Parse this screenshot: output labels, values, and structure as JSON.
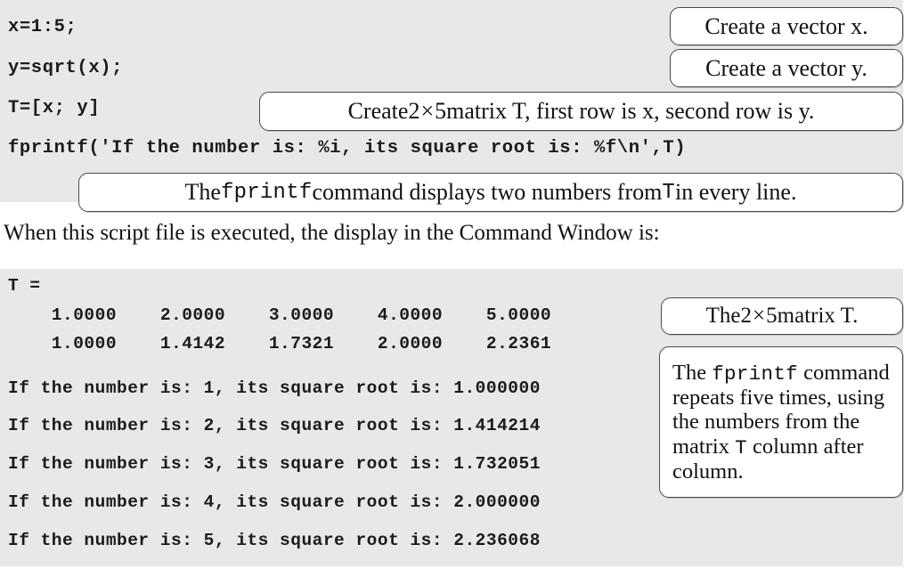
{
  "script_panel": {
    "lines": [
      "x=1:5;",
      "y=sqrt(x);",
      "T=[x; y]",
      "fprintf('If the number is: %i, its square root is: %f\\n',T)"
    ]
  },
  "body_text": {
    "sentence": "When this script file is executed, the display in the Command Window is:"
  },
  "output_panel": {
    "variable_header": "T =",
    "matrix_row_1": "    1.0000    2.0000    3.0000    4.0000    5.0000",
    "matrix_row_2": "    1.0000    1.4142    1.7321    2.0000    2.2361",
    "fprintf_lines": [
      "If the number is: 1, its square root is: 1.000000",
      "If the number is: 2, its square root is: 1.414214",
      "If the number is: 3, its square root is: 1.732051",
      "If the number is: 4, its square root is: 2.000000",
      "If the number is: 5, its square root is: 2.236068"
    ]
  },
  "callouts": {
    "vector_x": "Create a vector x.",
    "vector_y": "Create a vector y.",
    "matrix_t_parts": {
      "before": "Create ",
      "rows": "2",
      "times": "×",
      "cols": "5",
      "after": " matrix T, first row is x, second row is y."
    },
    "fprintf_displays_parts": {
      "before": "The ",
      "mono": "fprintf",
      "middle": " command displays two numbers from ",
      "mono2": "T",
      "after": " in every line."
    },
    "matrix_label_parts": {
      "before": "The ",
      "rows": "2",
      "times": "×",
      "cols": "5",
      "after": " matrix T."
    },
    "fprintf_repeats_parts": {
      "before": "The ",
      "mono": "fprintf",
      "middle": " command repeats five times, using the numbers from the matrix ",
      "mono2": "T",
      "after": " column after column."
    }
  },
  "colors": {
    "panel_background": "#e8e8e8",
    "page_background": "#ffffff",
    "text": "#1b1b1b",
    "callout_border": "#4a4a4a"
  }
}
